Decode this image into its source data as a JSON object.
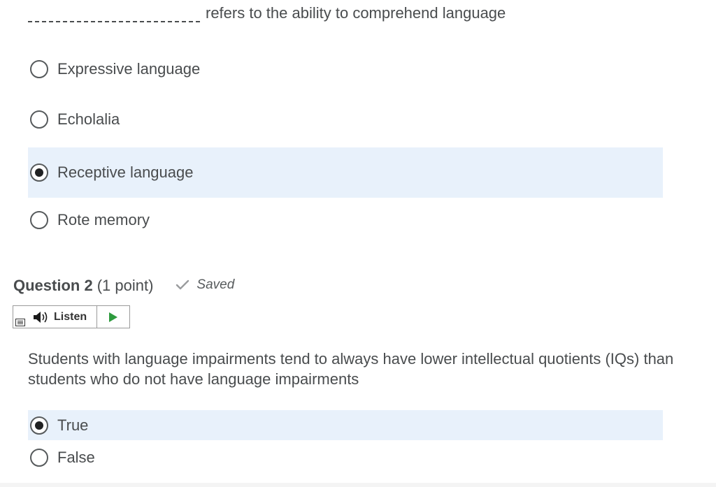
{
  "question1": {
    "stem_text": "refers to the ability to comprehend language",
    "options": [
      {
        "label": "Expressive language",
        "selected": false
      },
      {
        "label": "Echolalia",
        "selected": false
      },
      {
        "label": "Receptive language",
        "selected": true
      },
      {
        "label": "Rote memory",
        "selected": false
      }
    ]
  },
  "question2": {
    "title": "Question 2",
    "points": "(1 point)",
    "status": "Saved",
    "listen_label": "Listen",
    "stem_text": "Students with language impairments tend to always have lower intellectual quotients (IQs) than students who do not have language impairments",
    "options": [
      {
        "label": "True",
        "selected": true
      },
      {
        "label": "False",
        "selected": false
      }
    ]
  },
  "colors": {
    "selected_row_bg": "#e8f1fb",
    "text": "#494c4e",
    "play_green": "#2e9b3e"
  }
}
